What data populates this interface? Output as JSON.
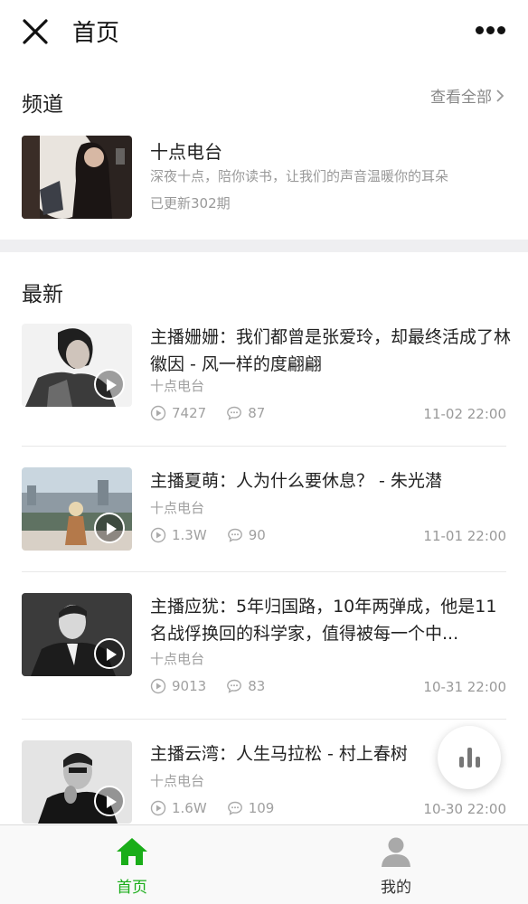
{
  "header": {
    "title": "首页"
  },
  "channel_section": {
    "title": "频道",
    "see_all": "查看全部",
    "channel": {
      "name": "十点电台",
      "description": "深夜十点，陪你读书，让我们的声音温暖你的耳朵",
      "updated": "已更新302期"
    }
  },
  "latest_section": {
    "title": "最新",
    "items": [
      {
        "title": "主播姗姗：我们都曾是张爱玲，却最终活成了林徽因 - 风一样的度翩翩",
        "source": "十点电台",
        "plays": "7427",
        "comments": "87",
        "date": "11-02 22:00"
      },
      {
        "title": "主播夏萌：人为什么要休息？ - 朱光潜",
        "source": "十点电台",
        "plays": "1.3W",
        "comments": "90",
        "date": "11-01 22:00"
      },
      {
        "title": "主播应犹：5年归国路，10年两弹成，他是11名战俘换回的科学家，值得被每一个中...",
        "source": "十点电台",
        "plays": "9013",
        "comments": "83",
        "date": "10-31 22:00"
      },
      {
        "title": "主播云湾：人生马拉松 - 村上春树",
        "source": "十点电台",
        "plays": "1.6W",
        "comments": "109",
        "date": "10-30 22:00"
      }
    ]
  },
  "bottom_nav": {
    "home": "首页",
    "mine": "我的"
  },
  "colors": {
    "accent": "#1aad19",
    "muted": "#999999",
    "divider": "#efeff1"
  }
}
